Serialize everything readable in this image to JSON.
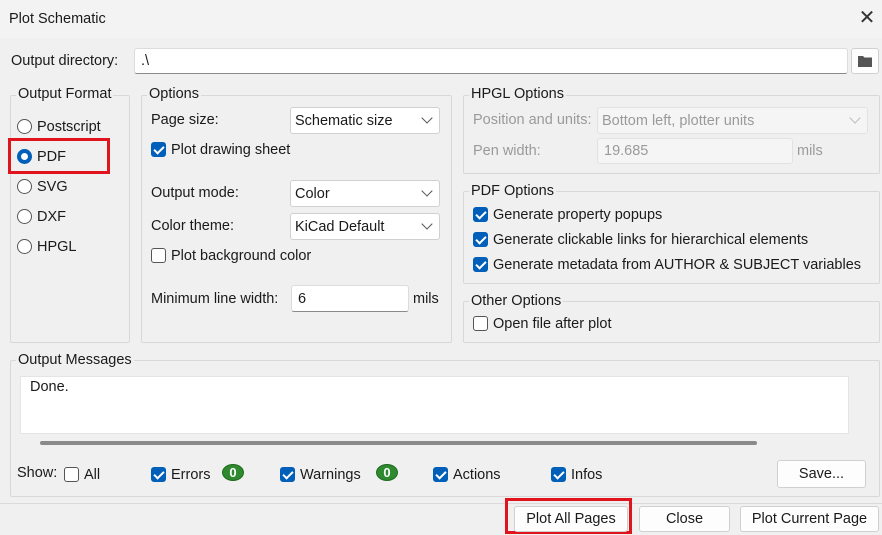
{
  "window": {
    "title": "Plot Schematic"
  },
  "output_directory": {
    "label": "Output directory:",
    "value": ".\\"
  },
  "output_format": {
    "title": "Output Format",
    "options": [
      {
        "label": "Postscript",
        "selected": false
      },
      {
        "label": "PDF",
        "selected": true
      },
      {
        "label": "SVG",
        "selected": false
      },
      {
        "label": "DXF",
        "selected": false
      },
      {
        "label": "HPGL",
        "selected": false
      }
    ]
  },
  "options": {
    "title": "Options",
    "page_size_label": "Page size:",
    "page_size_value": "Schematic size",
    "plot_drawing_sheet": "Plot drawing sheet",
    "output_mode_label": "Output mode:",
    "output_mode_value": "Color",
    "color_theme_label": "Color theme:",
    "color_theme_value": "KiCad Default",
    "plot_background_color": "Plot background color",
    "min_line_width_label": "Minimum line width:",
    "min_line_width_value": "6",
    "min_line_width_unit": "mils"
  },
  "hpgl_options": {
    "title": "HPGL Options",
    "position_label": "Position and units:",
    "position_value": "Bottom left, plotter units",
    "pen_width_label": "Pen width:",
    "pen_width_value": "19.685",
    "pen_width_unit": "mils"
  },
  "pdf_options": {
    "title": "PDF Options",
    "items": [
      "Generate property popups",
      "Generate clickable links for hierarchical elements",
      "Generate metadata from AUTHOR & SUBJECT variables"
    ]
  },
  "other_options": {
    "title": "Other Options",
    "open_file_after_plot": "Open file after plot"
  },
  "output_messages": {
    "title": "Output Messages",
    "text": "Done."
  },
  "show_filter": {
    "label": "Show:",
    "all": "All",
    "errors": "Errors",
    "errors_count": "0",
    "warnings": "Warnings",
    "warnings_count": "0",
    "actions": "Actions",
    "infos": "Infos",
    "save": "Save..."
  },
  "buttons": {
    "plot_all": "Plot All Pages",
    "close": "Close",
    "plot_current": "Plot Current Page"
  },
  "colors": {
    "accent": "#005fb8",
    "highlight": "#e0141c",
    "badge": "#2f8a2f"
  }
}
